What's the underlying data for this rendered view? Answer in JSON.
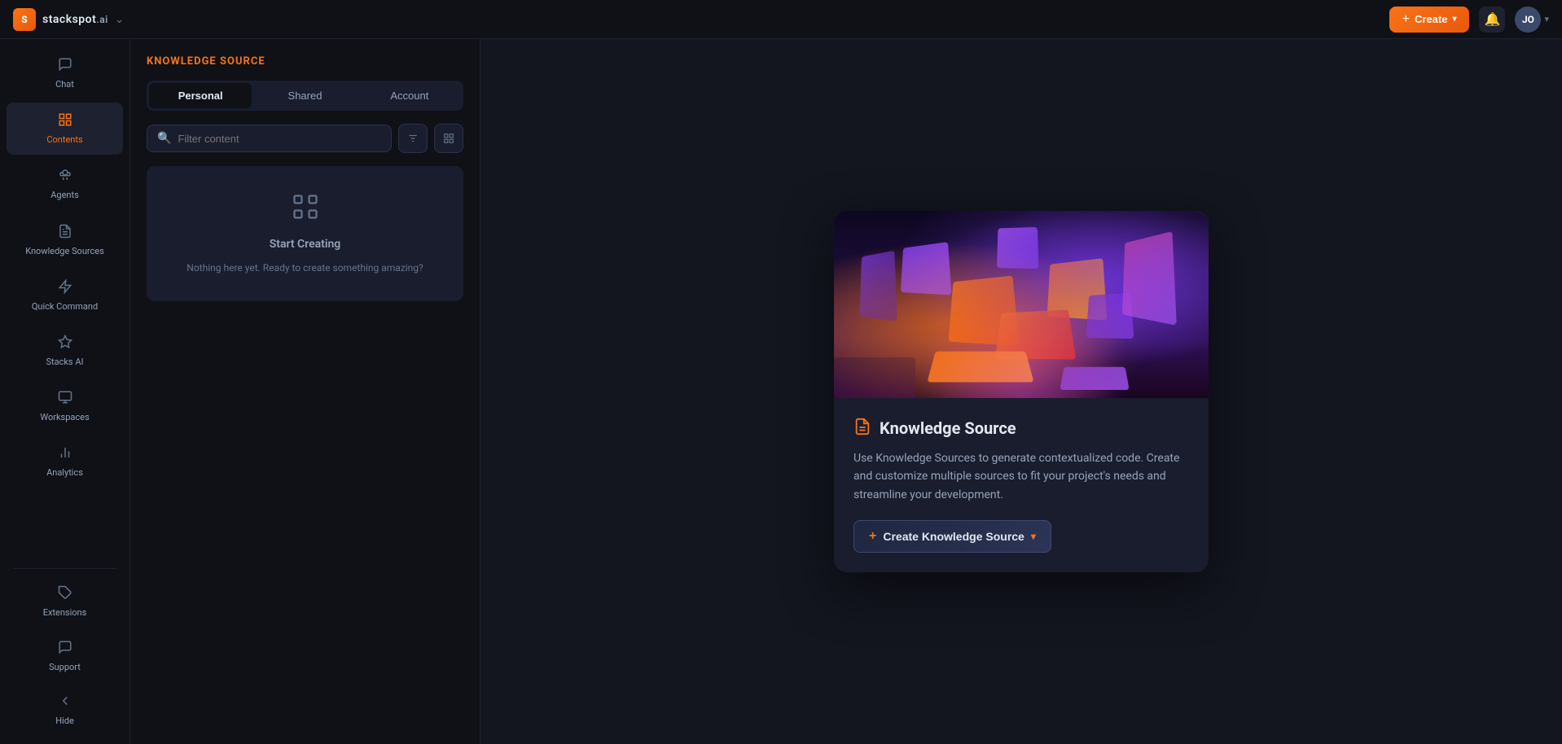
{
  "topbar": {
    "logo_text": "stackspot",
    "logo_ai": ".ai",
    "create_label": "Create",
    "avatar_initials": "JO"
  },
  "sidebar": {
    "items": [
      {
        "id": "chat",
        "label": "Chat",
        "icon": "💬"
      },
      {
        "id": "contents",
        "label": "Contents",
        "icon": "⊞",
        "active": true,
        "expanded": true
      },
      {
        "id": "agents",
        "label": "Agents",
        "icon": "🤖"
      },
      {
        "id": "knowledge-sources",
        "label": "Knowledge Sources",
        "icon": "📋"
      },
      {
        "id": "quick-command",
        "label": "Quick Command",
        "icon": "⚡"
      },
      {
        "id": "stacks-ai",
        "label": "Stacks AI",
        "icon": "◈"
      },
      {
        "id": "workspaces",
        "label": "Workspaces",
        "icon": "⊡"
      },
      {
        "id": "analytics",
        "label": "Analytics",
        "icon": "📊"
      }
    ],
    "bottom_items": [
      {
        "id": "extensions",
        "label": "Extensions",
        "icon": "🔌"
      },
      {
        "id": "support",
        "label": "Support",
        "icon": "💭"
      },
      {
        "id": "hide",
        "label": "Hide",
        "icon": "◁"
      }
    ]
  },
  "panel": {
    "title": "KNOWLEDGE SOURCE",
    "tabs": [
      {
        "id": "personal",
        "label": "Personal",
        "active": true
      },
      {
        "id": "shared",
        "label": "Shared",
        "active": false
      },
      {
        "id": "account",
        "label": "Account",
        "active": false
      }
    ],
    "search_placeholder": "Filter content",
    "empty_state": {
      "title": "Start Creating",
      "description": "Nothing here yet. Ready to create something amazing?"
    }
  },
  "promo": {
    "title": "Knowledge Source",
    "description": "Use Knowledge Sources to generate contextualized code. Create and customize multiple sources to fit your project's needs and streamline your development.",
    "cta_label": "Create Knowledge Source"
  }
}
